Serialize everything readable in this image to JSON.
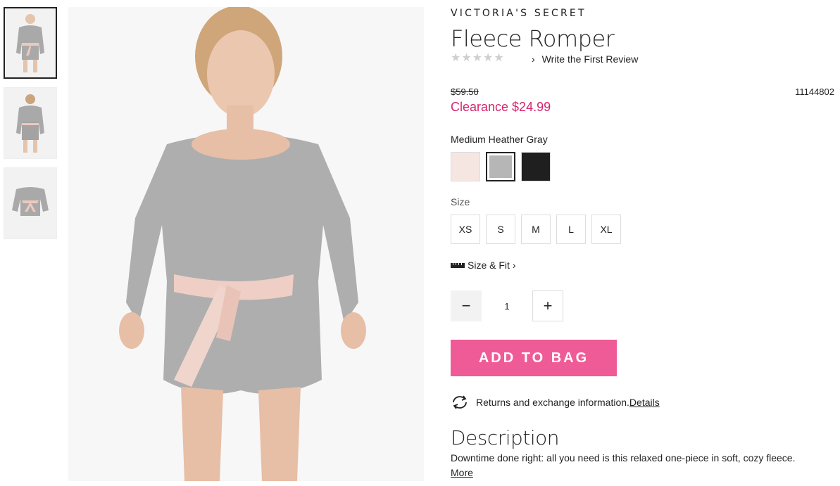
{
  "product": {
    "brand": "VICTORIA'S SECRET",
    "title": "Fleece Romper",
    "rating_stars": 0,
    "review_link": "Write the First Review",
    "original_price": "$59.50",
    "sale_price": "Clearance $24.99",
    "sku": "11144802"
  },
  "gallery": {
    "thumbnails": [
      "front-view",
      "back-view",
      "flat-lay"
    ],
    "selected_index": 0
  },
  "color": {
    "label": "Medium Heather Gray",
    "swatches": [
      {
        "name": "Light Pink",
        "hex": "#f6e6e1"
      },
      {
        "name": "Medium Heather Gray",
        "hex": "#b6b6b6"
      },
      {
        "name": "Black",
        "hex": "#1f1f1f"
      }
    ],
    "selected_index": 1
  },
  "size": {
    "label": "Size",
    "options": [
      "XS",
      "S",
      "M",
      "L",
      "XL"
    ]
  },
  "fit": {
    "label": "Size & Fit"
  },
  "quantity": {
    "value": "1"
  },
  "actions": {
    "add_to_bag": "ADD TO BAG"
  },
  "returns": {
    "text": "Returns and exchange information.",
    "link": "Details"
  },
  "description": {
    "heading": "Description",
    "text": "Downtime done right: all you need is this relaxed one-piece in soft, cozy fleece.",
    "more": "More"
  },
  "colors": {
    "accent_pink": "#ef5b96",
    "clearance_red": "#d8246e"
  }
}
